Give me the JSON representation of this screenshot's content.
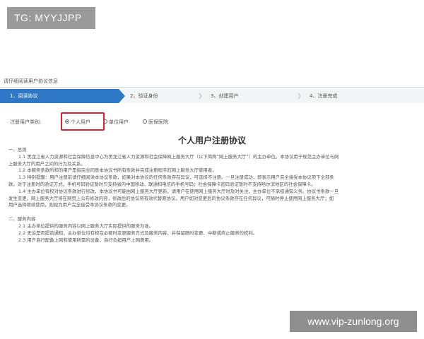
{
  "badge": {
    "text": "TG: MYYJJPP"
  },
  "panel": {
    "title": "请仔细阅读用户协议信息"
  },
  "steps": [
    {
      "label": "1、阅读协议"
    },
    {
      "label": "2、验证身份"
    },
    {
      "label": "3、创建用户"
    },
    {
      "label": "4、注册完成"
    }
  ],
  "user_type": {
    "label": "注册用户类别:",
    "options": [
      {
        "label": "个人用户",
        "selected": true
      },
      {
        "label": "单位用户",
        "selected": false
      },
      {
        "label": "医保医院",
        "selected": false
      }
    ]
  },
  "agreement": {
    "title": "个人用户注册协议",
    "sections": [
      "一、总则",
      "1.1 黑龙江省人力资源和社会保障信息中心为黑龙江省人力资源和社会保障网上服务大厅（以下简称“网上服务大厅”）的主办单位。本协议用于规范主办单位与网",
      "上服务大厅的用户之间的行为及关系。",
      "1.2 本服务条款所和的用户是指完全同意本协议书所有条款并完成注册程序的网上服务大厅使用者。",
      "1.3 特别提醒：用户注册前请仔细阅读本协议条款，如果对本协议的任何条款存在异议，可选择不注册。一旦注册成功，即表示用户完全接受本协议项下全部条",
      "款。对于注册时的验证方式，手机号码验证暂时只支持省内中国移动、联通和电信的手机号码；社会保障卡密码验证暂时不支持哈尔滨地区的社会保障卡。",
      "1.4 主办单位有权对协议条款进行修改，本协议书可能由网上服务大厅更新，请用户在使用网上服务大厅时及时关注，主办单位不承担通知义务。协议书条款一旦",
      "发生变更，网上服务大厅将在网页上公布修改内容，修改后的协议将有效代替原协议。用户如对变更后的协议条款存在任何异议，可随时停止使用网上服务大厅；如",
      "用户选择继续使用，则视为用户完全接受本协议条款的变更。",
      "二、服务内容",
      "2.1 主办单位提供的服务内容以网上服务大厅实际提供的服务为准。",
      "2.2 无论是否提前通知，主办单位均有权在必要时变更服务方式及服务内容，并保留随时变更、中断或终止服务的权利。",
      "2.3 用户自行配备上网和使用所需的设备，自行负担用户上网费用。"
    ]
  },
  "watermark": {
    "text": "www.vip-zunlong.org"
  },
  "colors": {
    "step_active": "#2f78c7",
    "highlight": "#e0222a"
  }
}
